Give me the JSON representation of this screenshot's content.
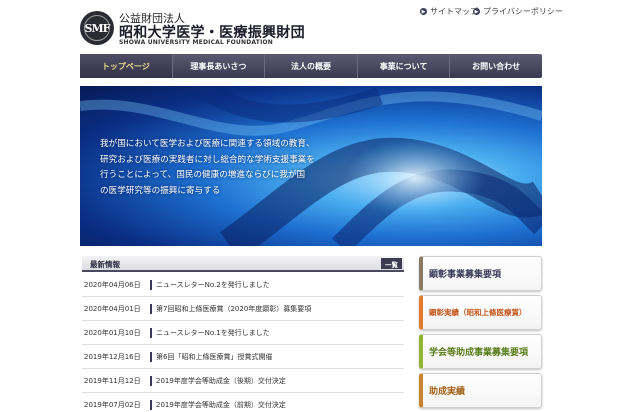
{
  "header": {
    "logo_text": "SMF",
    "org_type": "公益財団法人",
    "org_name": "昭和大学医学・医療振興財団",
    "org_name_en": "SHOWA UNIVERSITY MEDICAL FOUNDATION",
    "utility_links": [
      {
        "label": "サイトマップ",
        "icon": "arrow-circle-icon"
      },
      {
        "label": "プライバシーポリシー",
        "icon": "arrow-circle-icon"
      }
    ]
  },
  "nav": {
    "items": [
      {
        "label": "トップページ",
        "active": true
      },
      {
        "label": "理事長あいさつ",
        "active": false
      },
      {
        "label": "法人の概要",
        "active": false
      },
      {
        "label": "事業について",
        "active": false
      },
      {
        "label": "お問い合わせ",
        "active": false
      }
    ]
  },
  "hero": {
    "lines": [
      "我が国において医学および医療に関連する領域の教育、",
      "研究および医療の実践者に対し総合的な学術支援事業を",
      "行うことによって、国民の健康の増進ならびに我が国",
      "の医学研究等の振興に寄与する"
    ]
  },
  "news": {
    "title": "最新情報",
    "all_label": "一覧",
    "items": [
      {
        "date": "2020年04月06日",
        "text": "ニュースレターNo.2を発行しました"
      },
      {
        "date": "2020年04月01日",
        "text": "第7回昭和上條医療賞（2020年度顕彰）募集要項"
      },
      {
        "date": "2020年01月10日",
        "text": "ニュースレターNo.1を発行しました"
      },
      {
        "date": "2019年12月16日",
        "text": "第6回「昭和上條医療賞」授賞式開催"
      },
      {
        "date": "2019年11月12日",
        "text": "2019年度学会等助成金（後期）交付決定"
      },
      {
        "date": "2019年07月02日",
        "text": "2019年度学会等助成金（前期）交付決定"
      }
    ]
  },
  "side_banners": [
    {
      "label": "顕彰事業募集要項",
      "accent": "#8a7a64"
    },
    {
      "label": "顕彰実績（昭和上條医療賞）",
      "accent": "#e07a2c"
    },
    {
      "label": "学会等助成事業募集要項",
      "accent": "#93b533"
    },
    {
      "label": "助成実績",
      "accent": "#c8842e"
    }
  ],
  "colors": {
    "nav_bg": "#3a3950",
    "nav_active_text": "#f0dd8a",
    "hero_blue": "#1d6fd0"
  }
}
